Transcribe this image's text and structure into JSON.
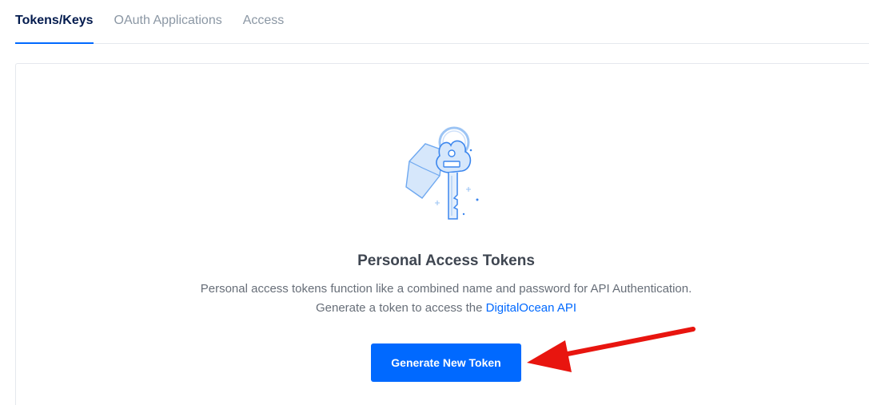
{
  "tabs": [
    {
      "label": "Tokens/Keys",
      "active": true
    },
    {
      "label": "OAuth Applications",
      "active": false
    },
    {
      "label": "Access",
      "active": false
    }
  ],
  "empty_state": {
    "icon": "key-icon",
    "title": "Personal Access Tokens",
    "description_line1": "Personal access tokens function like a combined name and password for API Authentication.",
    "description_line2_prefix": "Generate a token to access the",
    "link_text": "DigitalOcean API",
    "button_label": "Generate New Token"
  },
  "annotation": {
    "arrow_color": "#e8150f"
  },
  "colors": {
    "accent": "#0069ff",
    "heading": "#031b4e"
  }
}
